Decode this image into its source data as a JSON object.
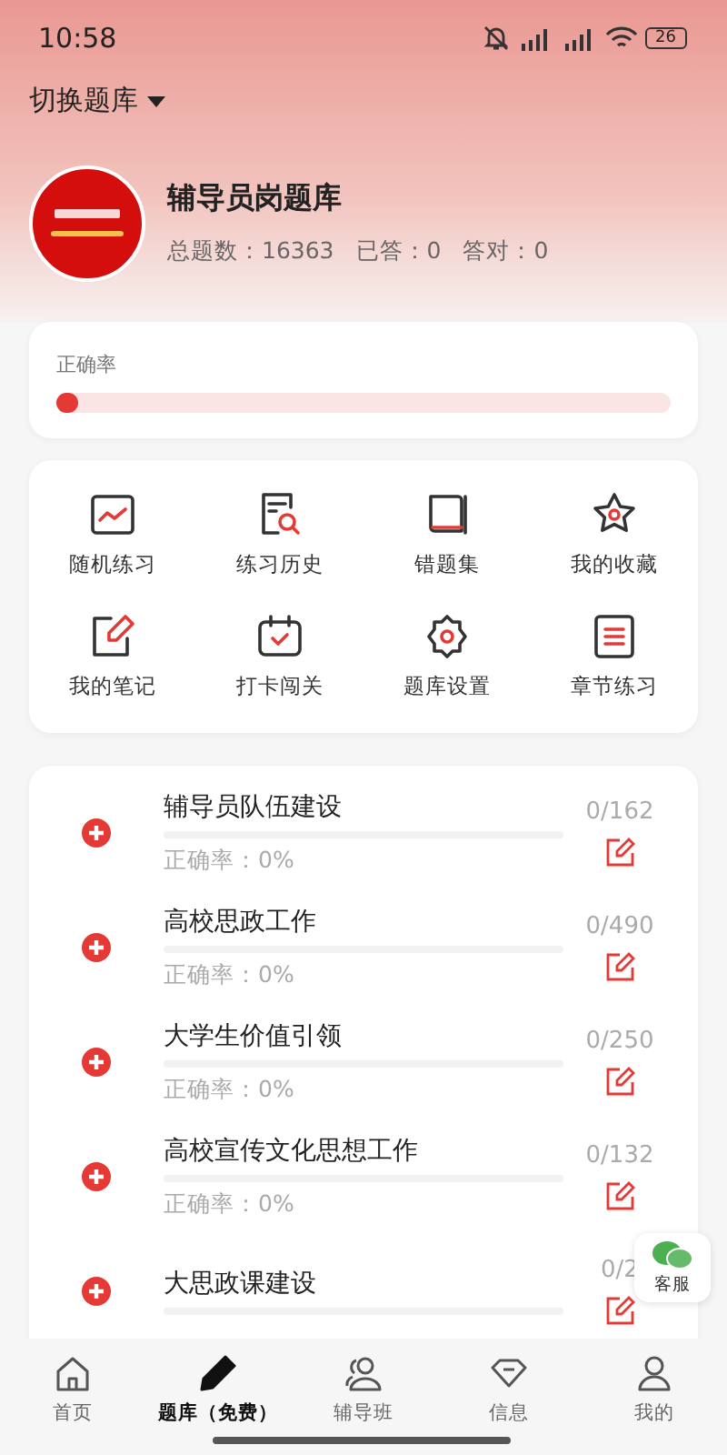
{
  "status_bar": {
    "time": "10:58",
    "battery": "26"
  },
  "switch_bank": {
    "label": "切换题库"
  },
  "bank": {
    "name": "辅导员岗题库",
    "stats": [
      {
        "label": "总题数：",
        "value": "16363"
      },
      {
        "label": "已答：",
        "value": "0"
      },
      {
        "label": "答对：",
        "value": "0"
      }
    ]
  },
  "accuracy": {
    "label": "正确率",
    "level": 0
  },
  "tools": [
    {
      "kind": "chart",
      "label": "随机练习"
    },
    {
      "kind": "history",
      "label": "练习历史"
    },
    {
      "kind": "book",
      "label": "错题集"
    },
    {
      "kind": "star",
      "label": "我的收藏"
    },
    {
      "kind": "note",
      "label": "我的笔记"
    },
    {
      "kind": "calendar",
      "label": "打卡闯关"
    },
    {
      "kind": "gear",
      "label": "题库设置"
    },
    {
      "kind": "doc",
      "label": "章节练习"
    }
  ],
  "chapters": [
    {
      "title": "辅导员队伍建设",
      "accuracy": "正确率：0%",
      "count": "0/162",
      "level": 0
    },
    {
      "title": "高校思政工作",
      "accuracy": "正确率：0%",
      "count": "0/490",
      "level": 0
    },
    {
      "title": "大学生价值引领",
      "accuracy": "正确率：0%",
      "count": "0/250",
      "level": 0
    },
    {
      "title": "高校宣传文化思想工作",
      "accuracy": "正确率：0%",
      "count": "0/132",
      "level": 0
    },
    {
      "title": "大思政课建设",
      "count": "0/2",
      "level": 0
    }
  ],
  "service": {
    "label": "客服"
  },
  "nav": [
    {
      "kind": "home",
      "label": "首页",
      "selected": false
    },
    {
      "kind": "pencil",
      "label": "题库（免费）",
      "selected": true
    },
    {
      "kind": "group",
      "label": "辅导班",
      "selected": false
    },
    {
      "kind": "message",
      "label": "信息",
      "selected": false
    },
    {
      "kind": "user",
      "label": "我的",
      "selected": false
    }
  ]
}
